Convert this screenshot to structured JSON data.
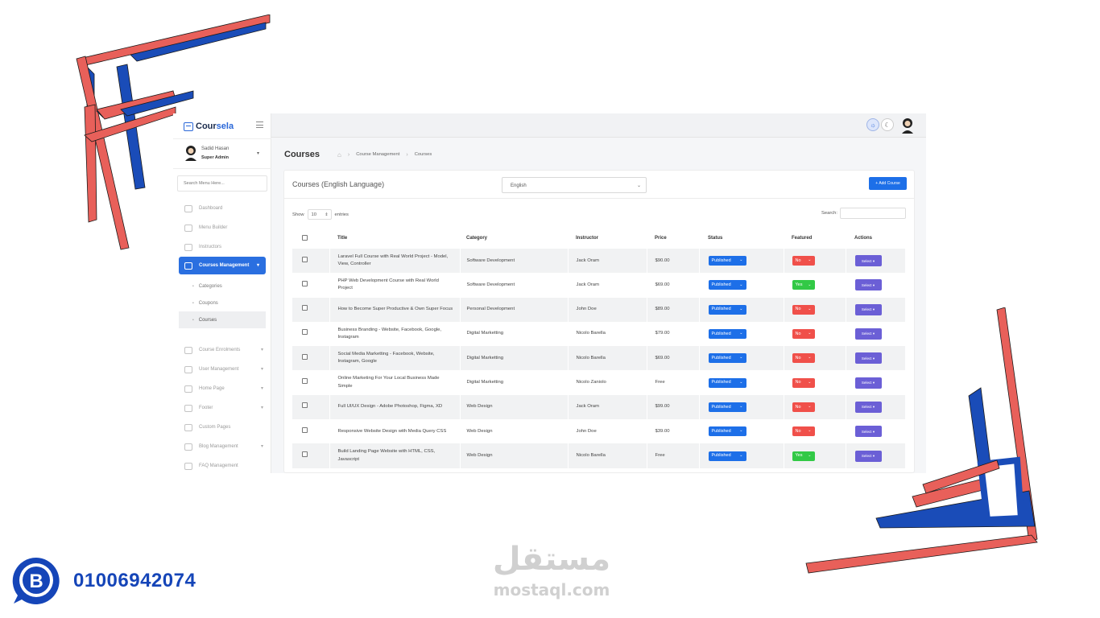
{
  "app": {
    "brand_prefix": "Cour",
    "brand_suffix": "sela",
    "user": {
      "name": "Sadid Hasan",
      "role": "Super Admin"
    },
    "search_placeholder": "Search Menu Here...",
    "menu": [
      {
        "label": "Dashboard",
        "icon": "dashboard-icon",
        "expandable": false
      },
      {
        "label": "Menu Builder",
        "icon": "menu-icon",
        "expandable": false
      },
      {
        "label": "Instructors",
        "icon": "instructors-icon",
        "expandable": false
      },
      {
        "label": "Courses Management",
        "icon": "courses-icon",
        "expandable": true,
        "active": true
      },
      {
        "label": "Course Enrolments",
        "icon": "enrolment-icon",
        "expandable": true
      },
      {
        "label": "User Management",
        "icon": "users-icon",
        "expandable": true
      },
      {
        "label": "Home Page",
        "icon": "layers-icon",
        "expandable": true
      },
      {
        "label": "Footer",
        "icon": "footer-icon",
        "expandable": true
      },
      {
        "label": "Custom Pages",
        "icon": "page-icon",
        "expandable": false
      },
      {
        "label": "Blog Management",
        "icon": "blog-icon",
        "expandable": true
      },
      {
        "label": "FAQ Management",
        "icon": "faq-icon",
        "expandable": false
      }
    ],
    "submenu": [
      "Categories",
      "Coupons",
      "Courses"
    ]
  },
  "page": {
    "title": "Courses",
    "breadcrumb": [
      "Course Management",
      "Courses"
    ]
  },
  "card": {
    "title": "Courses (English Language)",
    "language_selected": "English",
    "add_button": "+ Add Course",
    "show_label": "Show",
    "entries_value": "10",
    "entries_label": "entries",
    "search_label": "Search:"
  },
  "table": {
    "headers": [
      "Title",
      "Category",
      "Instructor",
      "Price",
      "Status",
      "Featured",
      "Actions"
    ],
    "rows": [
      {
        "title": "Laravel Full Course with Real World Project - Model, View, Controller",
        "category": "Software Development",
        "instructor": "Jack Oram",
        "price": "$90.00",
        "status": "Published",
        "featured": "No",
        "action": "Select"
      },
      {
        "title": "PHP Web Development Course with Real World Project",
        "category": "Software Development",
        "instructor": "Jack Oram",
        "price": "$69.00",
        "status": "Published",
        "featured": "Yes",
        "action": "Select"
      },
      {
        "title": "How to Become Super Productive & Own Super Focus",
        "category": "Personal Development",
        "instructor": "John Doe",
        "price": "$89.00",
        "status": "Published",
        "featured": "No",
        "action": "Select"
      },
      {
        "title": "Business Branding - Website, Facebook, Google, Instagram",
        "category": "Digital Marketting",
        "instructor": "Nicolo Barella",
        "price": "$79.00",
        "status": "Published",
        "featured": "No",
        "action": "Select"
      },
      {
        "title": "Social Media Marketting - Facebook, Website, Instagram, Google",
        "category": "Digital Marketting",
        "instructor": "Nicolo Barella",
        "price": "$69.00",
        "status": "Published",
        "featured": "No",
        "action": "Select"
      },
      {
        "title": "Online Marketing For Your Local Business Made Simple",
        "category": "Digital Marketting",
        "instructor": "Nicolo Zaniolo",
        "price": "Free",
        "status": "Published",
        "featured": "No",
        "action": "Select"
      },
      {
        "title": "Full UI/UX Design - Adobe Photoshop, Figma, XD",
        "category": "Web Design",
        "instructor": "Jack Oram",
        "price": "$99.00",
        "status": "Published",
        "featured": "No",
        "action": "Select"
      },
      {
        "title": "Responsive Website Design with Media Query CSS",
        "category": "Web Design",
        "instructor": "John Doe",
        "price": "$39.00",
        "status": "Published",
        "featured": "No",
        "action": "Select"
      },
      {
        "title": "Build Landing Page Website with HTML, CSS, Javascript",
        "category": "Web Design",
        "instructor": "Nicolo Barella",
        "price": "Free",
        "status": "Published",
        "featured": "Yes",
        "action": "Select"
      }
    ]
  },
  "footer": {
    "phone": "01006942074",
    "watermark_ar": "مستقل",
    "watermark_en": "mostaql.com"
  },
  "colors": {
    "primary": "#1d6fe8",
    "danger": "#f0504a",
    "success": "#32c946",
    "action": "#6b5fd6",
    "deco_red": "#e8605a",
    "deco_blue": "#1a4cb8"
  }
}
